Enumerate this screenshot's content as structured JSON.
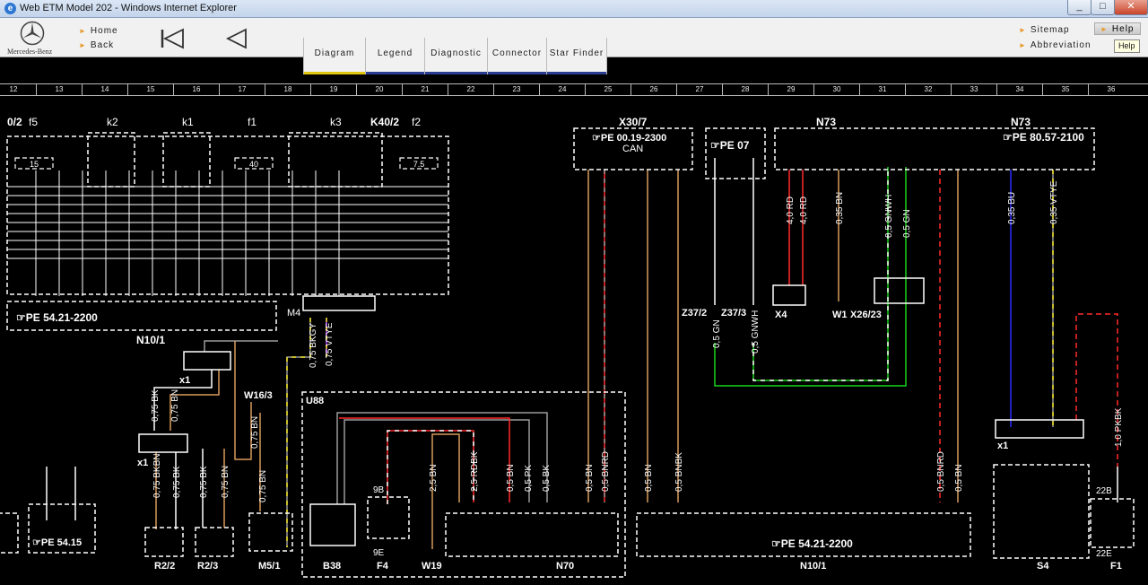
{
  "window": {
    "title": "Web ETM Model 202 - Windows Internet Explorer",
    "controls": [
      "_",
      "□",
      "✕"
    ]
  },
  "toolbar": {
    "brand": "Mercedes-Benz",
    "home_label": "Home",
    "back_label": "Back",
    "tabs": [
      {
        "label": "Diagram",
        "active": true
      },
      {
        "label": "Legend",
        "active": false
      },
      {
        "label": "Diagnostic",
        "active": false
      },
      {
        "label": "Connector",
        "active": false
      },
      {
        "label": "Star Finder",
        "active": false
      }
    ],
    "sitemap_label": "Sitemap",
    "abbreviation_label": "Abbreviation",
    "help_label": "Help",
    "help_tooltip": "Help"
  },
  "ruler": [
    "12",
    "13",
    "14",
    "15",
    "16",
    "17",
    "18",
    "19",
    "20",
    "21",
    "22",
    "23",
    "24",
    "25",
    "26",
    "27",
    "28",
    "29",
    "30",
    "31",
    "32",
    "33",
    "34",
    "35",
    "36"
  ],
  "diagram": {
    "components": {
      "k2": "k2",
      "k1": "k1",
      "f1": "f1",
      "k3": "k3",
      "k40_2": "K40/2",
      "f2": "f2",
      "f5": "f5",
      "left_frag": "0/2",
      "x30_7": "X30/7",
      "n73_a": "N73",
      "n73_b": "N73",
      "n10_1_top": "N10/1",
      "n10_1_bottom": "N10/1",
      "x1_a": "x1",
      "x1_b": "x1",
      "x1_c": "x1",
      "w16_3": "W16/3",
      "u88": "U88",
      "r2_2": "R2/2",
      "r2_3": "R2/3",
      "m5_1": "M5/1",
      "b38": "B38",
      "f4": "F4",
      "w19": "W19",
      "n70": "N70",
      "s4": "S4",
      "f1b": "F1",
      "z37_2": "Z37/2",
      "z37_3": "Z37/3",
      "x4": "X4",
      "w1": "W1",
      "x26_23": "X26/23",
      "m4": "M4",
      "can": "CAN",
      "pin_9b": "9B",
      "pin_9e": "9E",
      "pin_22b": "22B",
      "pin_22e": "22E"
    },
    "page_refs": {
      "pe_54_21_left": "PE 54.21-2200",
      "pe_54_21_right": "PE 54.21-2200",
      "pe_00_19": "PE 00.19-2300",
      "pe_07": "PE 07",
      "pe_80_57": "PE 80.57-2100",
      "pe_54_15": "PE 54.15"
    },
    "fuse_values": {
      "f5": "15",
      "f1": "40",
      "f2": "7.5"
    },
    "wire_labels": {
      "w_075_bkgy": "0,75 BKGY",
      "w_075_vtye": "0,75 VTYE",
      "w_075_bk_1": "0,75 BK",
      "w_075_bn_1": "0,75 BN",
      "w_075_bkbn": "0,75 BKBN",
      "w_075_bk_2": "0,75 BK",
      "w_075_bk_3": "0,75 BK",
      "w_075_bn_2": "0,75 BN",
      "w_075_bn_3": "0,75 BN",
      "w_075_bn_4": "0,75 BN",
      "w_25_bn": "2,5 BN",
      "w_25_rdbk": "2,5 RDBK",
      "w_05_bn_1": "0,5 BN",
      "w_05_pk": "0,5 PK",
      "w_05_bk": "0,5 BK",
      "w_05_bn_2": "0,5 BN",
      "w_05_bnrd_1": "0,5 BNRD",
      "w_05_bn_3": "0,5 BN",
      "w_05_bnbk": "0,5 BNBK",
      "w_05_gn_1": "0,5 GN",
      "w_05_gnwh_1": "0,5 GNWH",
      "w_40_rd_1": "4,0 RD",
      "w_40_rd_2": "4,0 RD",
      "w_035_bn": "0,35 BN",
      "w_05_gnwh_2": "0,5 GNWH",
      "w_05_gn_2": "0,5 GN",
      "w_05_bnrd_2": "0,5 BNRD",
      "w_05_bn_4": "0,5 BN",
      "w_035_bu": "0,35 BU",
      "w_035_vtye": "0,35 VTYE",
      "w_10_pkbk": "1,0 PKBK"
    },
    "colors": {
      "brown": "#d99a5b",
      "red": "#ff2a2a",
      "green": "#19d419",
      "blue": "#2a2aff",
      "yellow": "#f0e020",
      "violet": "#b040ff",
      "white": "#ffffff",
      "gray": "#9a9a9a"
    }
  }
}
